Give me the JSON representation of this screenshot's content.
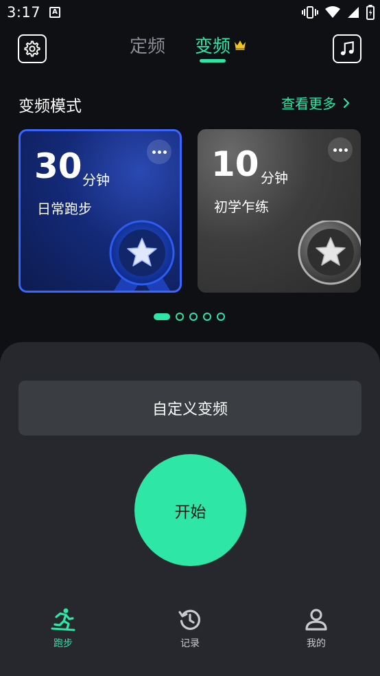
{
  "status_bar": {
    "time": "3:17",
    "notification_letter": "A",
    "icons": [
      "vibrate-icon",
      "wifi-icon",
      "signal-icon",
      "battery-icon"
    ]
  },
  "header": {
    "tabs": [
      {
        "label": "定频",
        "active": false
      },
      {
        "label": "变频",
        "active": true
      }
    ],
    "crown_icon": "crown-icon",
    "settings_icon": "gear-icon",
    "music_icon": "music-note-icon"
  },
  "section": {
    "title": "变频模式",
    "see_more": "查看更多"
  },
  "cards": [
    {
      "minutes": "30",
      "unit": "分钟",
      "name": "日常跑步",
      "style": "blue",
      "selected": true
    },
    {
      "minutes": "10",
      "unit": "分钟",
      "name": "初学乍练",
      "style": "gray",
      "selected": false
    }
  ],
  "pagination": {
    "total": 5,
    "current": 1
  },
  "actions": {
    "custom_label": "自定义变频",
    "start_label": "开始"
  },
  "nav": {
    "items": [
      {
        "label": "跑步",
        "icon": "runner-icon",
        "active": true
      },
      {
        "label": "记录",
        "icon": "history-icon",
        "active": false
      },
      {
        "label": "我的",
        "icon": "profile-icon",
        "active": false
      }
    ]
  },
  "colors": {
    "accent": "#2ee6a6",
    "background": "#0e1014",
    "sheet": "#26282d",
    "card_blue_border": "#3a66ff",
    "crown": "#f5c518"
  }
}
